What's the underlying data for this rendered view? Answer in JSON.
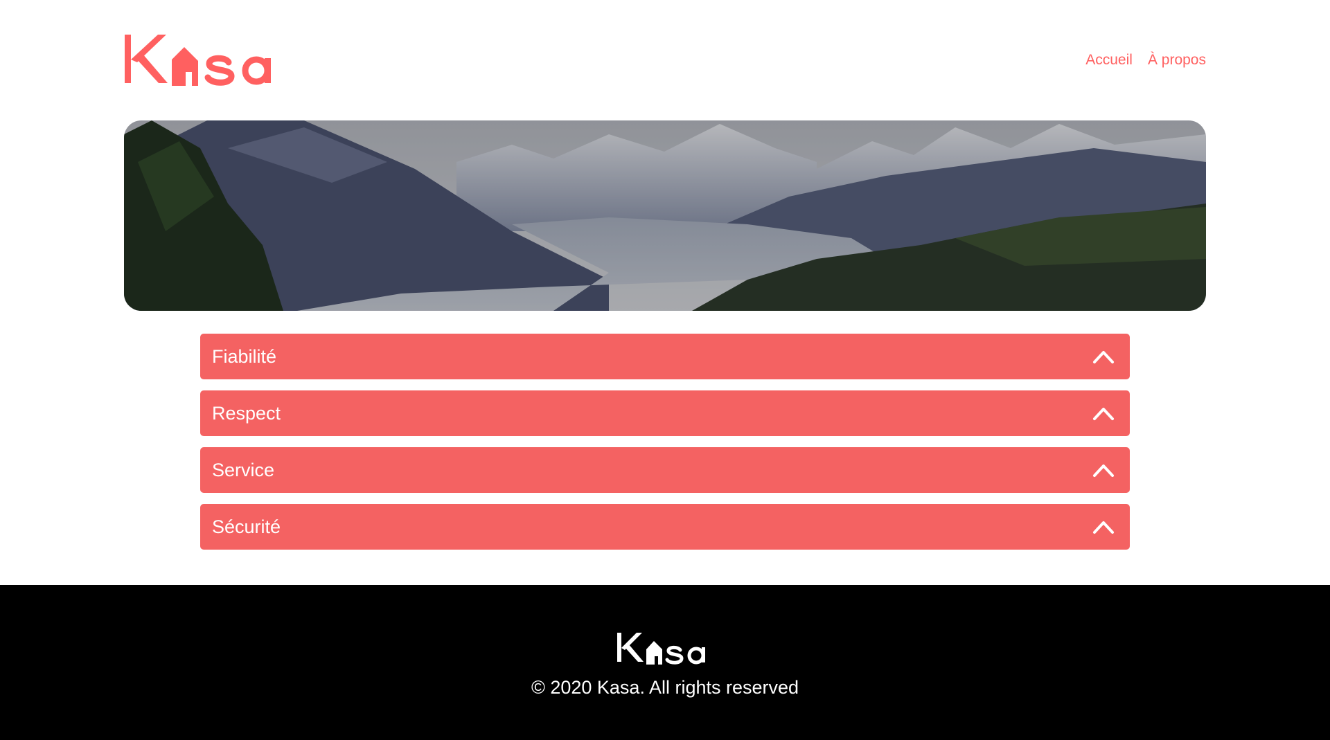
{
  "header": {
    "logo_text": "Kasa",
    "nav": [
      {
        "label": "Accueil"
      },
      {
        "label": "À propos"
      }
    ]
  },
  "banner": {
    "image_alt": "mountain-valley-landscape"
  },
  "collapses": [
    {
      "title": "Fiabilité",
      "icon": "chevron-up-icon"
    },
    {
      "title": "Respect",
      "icon": "chevron-up-icon"
    },
    {
      "title": "Service",
      "icon": "chevron-up-icon"
    },
    {
      "title": "Sécurité",
      "icon": "chevron-up-icon"
    }
  ],
  "footer": {
    "logo_text": "Kasa",
    "copyright": "© 2020 Kasa. All rights reserved"
  },
  "colors": {
    "brand": "#ff6060",
    "collapse_bg": "#f46262",
    "footer_bg": "#000000",
    "text_light": "#ffffff"
  }
}
